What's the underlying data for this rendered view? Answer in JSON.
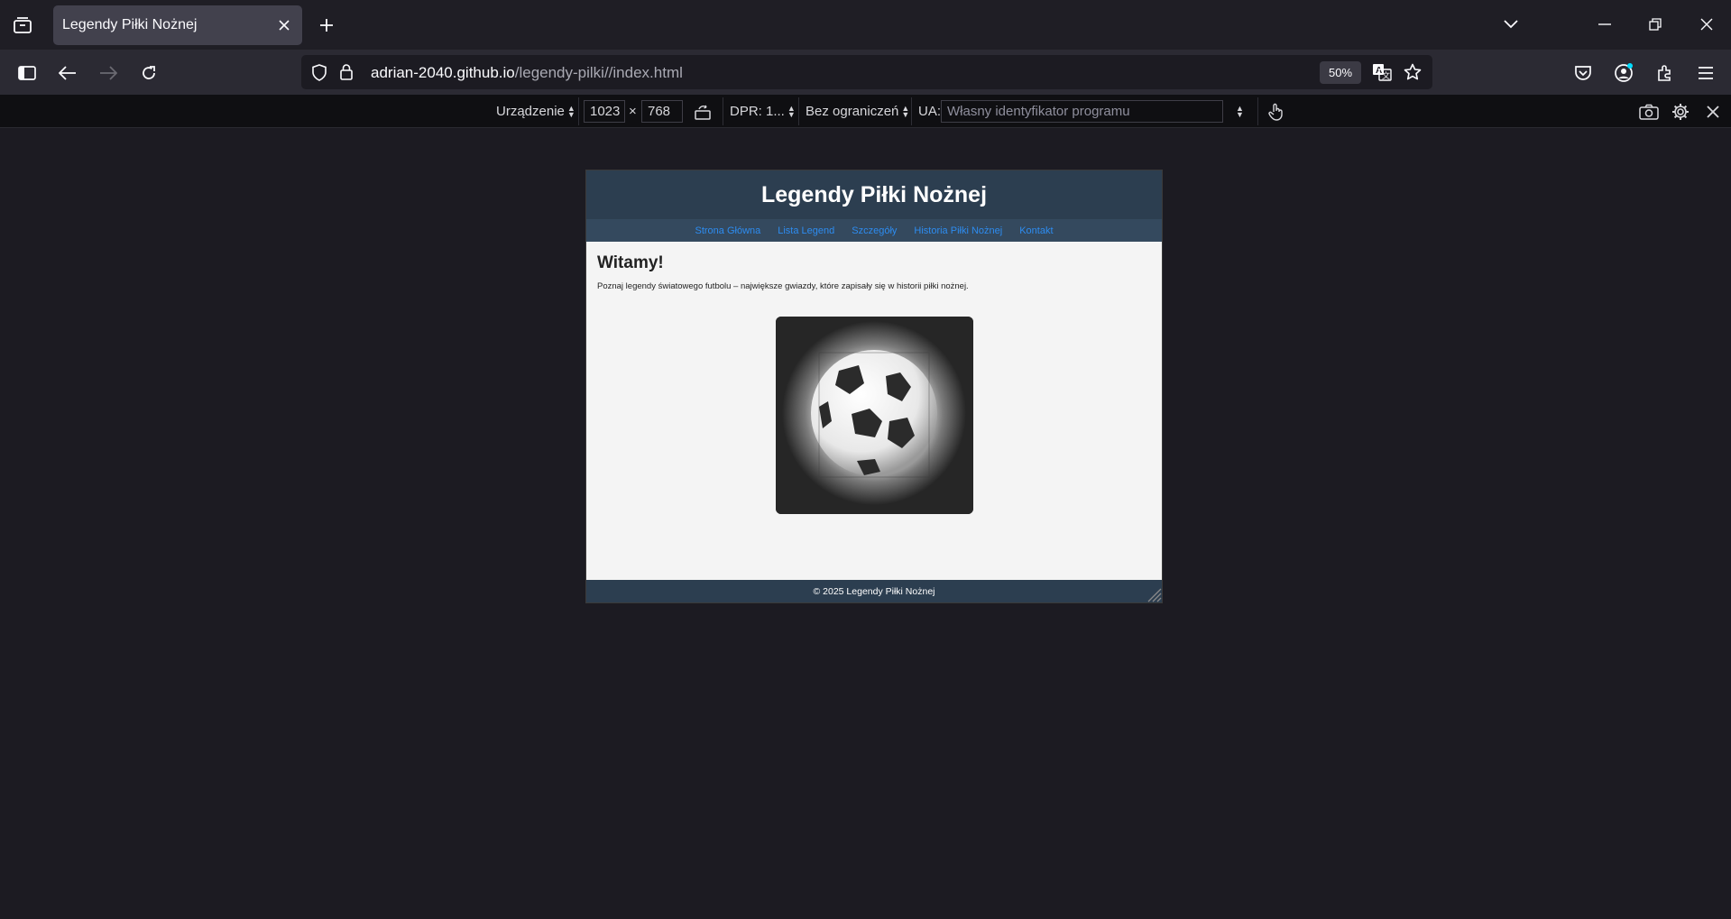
{
  "browser": {
    "tab_title": "Legendy Piłki Nożnej",
    "url_host": "adrian-2040.github.io",
    "url_path": "/legendy-pilki//index.html",
    "zoom": "50%"
  },
  "rdm": {
    "device_label": "Urządzenie",
    "width": "1023",
    "times": "×",
    "height": "768",
    "dpr_label": "DPR: 1...",
    "throttle_label": "Bez ograniczeń",
    "ua_label": "UA:",
    "ua_placeholder": "Własny identyfikator programu"
  },
  "site": {
    "title": "Legendy Piłki Nożnej",
    "nav": [
      "Strona Główna",
      "Lista Legend",
      "Szczegóły",
      "Historia Piłki Nożnej",
      "Kontakt"
    ],
    "heading": "Witamy!",
    "intro": "Poznaj legendy światowego futbolu – największe gwiazdy, które zapisały się w historii piłki nożnej.",
    "footer": "© 2025 Legendy Piłki Nożnej"
  }
}
